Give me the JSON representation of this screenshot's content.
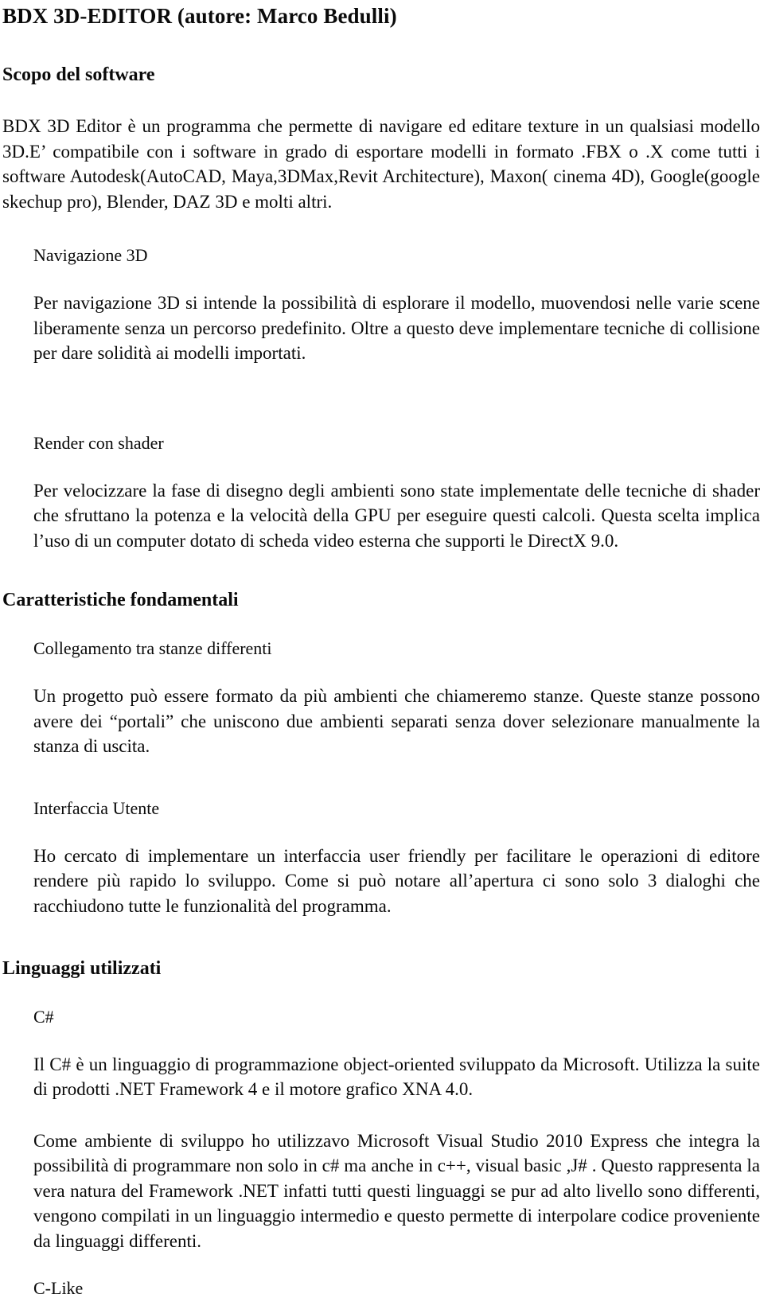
{
  "document": {
    "title": "BDX 3D-EDITOR  (autore: Marco Bedulli)",
    "sections": [
      {
        "heading": "Scopo del software",
        "intro": "BDX 3D Editor  è un programma che permette di navigare ed editare texture in un qualsiasi   modello 3D.E’ compatibile con i software in grado di esportare modelli in formato .FBX o .X come tutti i software Autodesk(AutoCAD, Maya,3DMax,Revit Architecture), Maxon( cinema 4D), Google(google skechup pro), Blender, DAZ 3D e molti altri.",
        "subsections": [
          {
            "subheading": "Navigazione 3D",
            "body": "Per navigazione 3D si intende la possibilità di esplorare il modello, muovendosi nelle varie scene liberamente senza un percorso predefinito. Oltre a questo deve implementare tecniche di collisione per dare solidità ai modelli importati."
          },
          {
            "subheading": "Render con shader",
            "body": "Per velocizzare la fase di disegno degli ambienti sono state implementate delle tecniche di shader che  sfruttano la potenza e la velocità della GPU per eseguire questi calcoli. Questa scelta implica l’uso di un computer dotato di scheda video esterna che supporti le DirectX 9.0."
          }
        ]
      },
      {
        "heading": "Caratteristiche fondamentali",
        "subsections": [
          {
            "subheading": "Collegamento tra stanze differenti",
            "body": "Un progetto può essere formato da più ambienti che chiameremo stanze. Queste stanze possono avere dei “portali” che uniscono due ambienti separati senza dover selezionare manualmente la stanza di uscita."
          },
          {
            "subheading": "Interfaccia Utente",
            "body": "Ho cercato di implementare un interfaccia user friendly per facilitare le operazioni di editore rendere più rapido lo sviluppo. Come si può notare  all’apertura ci sono solo 3 dialoghi che racchiudono tutte le funzionalità del programma."
          }
        ]
      },
      {
        "heading": "Linguaggi utilizzati",
        "subsections": [
          {
            "subheading": "C#",
            "body": "Il C# è un linguaggio di programmazione object-oriented sviluppato da Microsoft. Utilizza la suite di prodotti .NET Framework 4 e  il motore grafico XNA 4.0.",
            "body2": "Come ambiente di sviluppo ho utilizzavo Microsoft Visual Studio 2010 Express che integra la possibilità di programmare non solo in c# ma anche in c++, visual basic  ,J# . Questo rappresenta la vera natura del Framework .NET  infatti tutti questi linguaggi se pur ad alto livello sono differenti, vengono compilati in un linguaggio intermedio e questo permette di interpolare  codice proveniente da linguaggi differenti."
          },
          {
            "subheading": "C-Like"
          }
        ]
      }
    ]
  }
}
